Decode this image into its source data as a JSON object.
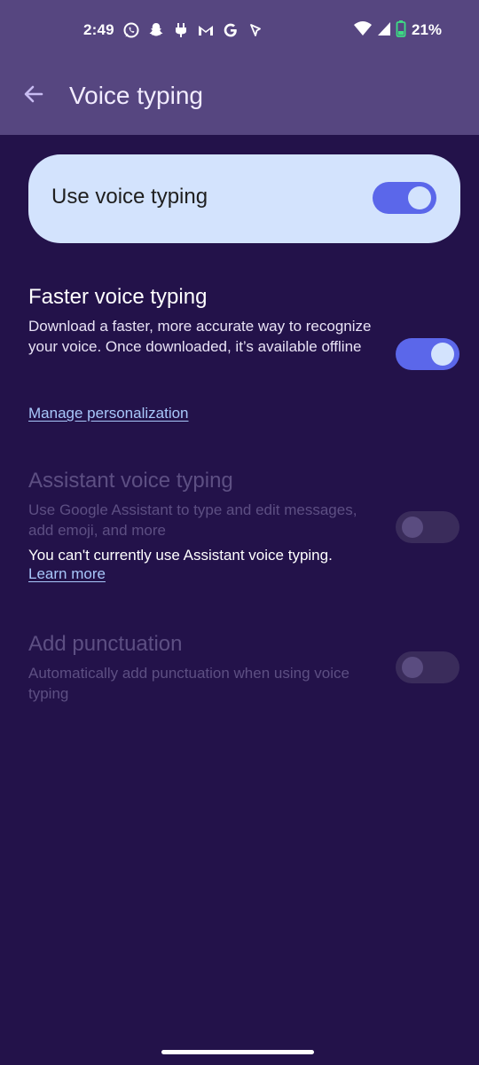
{
  "status_bar": {
    "time": "2:49",
    "battery_percent": "21%",
    "icons_left": [
      "whatsapp-icon",
      "snapchat-icon",
      "usb-icon",
      "gmail-icon",
      "google-icon",
      "nav-arrow-icon"
    ],
    "icons_right": [
      "wifi-icon",
      "signal-icon",
      "battery-icon"
    ]
  },
  "app_bar": {
    "title": "Voice typing",
    "back_icon": "arrow-back-icon"
  },
  "main_toggle": {
    "label": "Use voice typing",
    "state": "on"
  },
  "settings": [
    {
      "title": "Faster voice typing",
      "description": "Download a faster, more accurate way to recognize your voice. Once downloaded, it’s available offline",
      "state": "on",
      "enabled": true
    },
    {
      "title": "Assistant voice typing",
      "description": "Use Google Assistant to type and edit messages, add emoji, and more",
      "warning": "You can't currently use Assistant voice typing.",
      "link": "Learn more",
      "state": "off",
      "enabled": false
    },
    {
      "title": "Add punctuation",
      "description": "Automatically add punctuation when using voice typing",
      "state": "off",
      "enabled": false
    }
  ],
  "manage_link": "Manage personalization",
  "colors": {
    "background": "#23124a",
    "app_bar": "#564680",
    "accent": "#5b67ea",
    "card": "#d3e3fd",
    "link": "#a8c7fa"
  }
}
